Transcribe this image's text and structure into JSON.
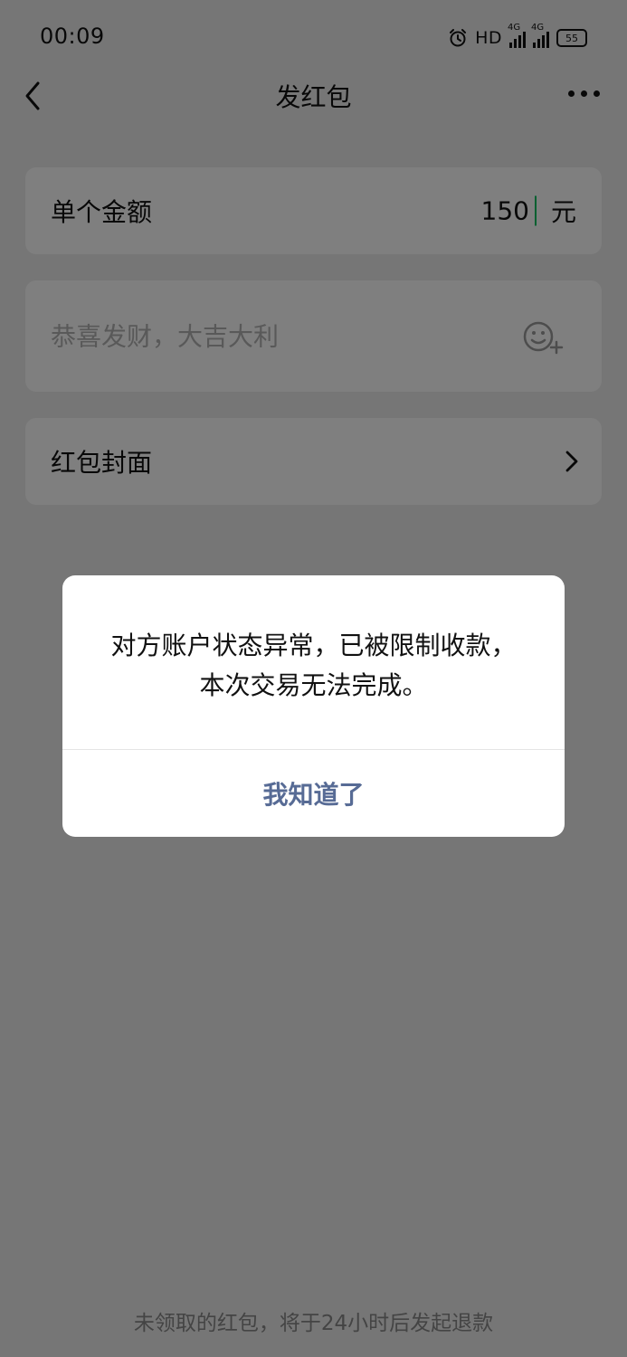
{
  "status_bar": {
    "time": "00:09",
    "hd_label": "HD",
    "network_1": "4G",
    "network_2": "4G",
    "battery": "55"
  },
  "nav": {
    "title": "发红包"
  },
  "amount": {
    "label": "单个金额",
    "value": "150",
    "unit": "元"
  },
  "greeting": {
    "placeholder": "恭喜发财，大吉大利"
  },
  "cover": {
    "label": "红包封面"
  },
  "footer": {
    "refund_note": "未领取的红包，将于24小时后发起退款"
  },
  "dialog": {
    "message": "对方账户状态异常，已被限制收款，本次交易无法完成。",
    "button_label": "我知道了"
  },
  "colors": {
    "accent_link": "#576b95",
    "page_bg": "#ededed",
    "card_bg": "#ffffff",
    "cursor": "#07c160"
  }
}
